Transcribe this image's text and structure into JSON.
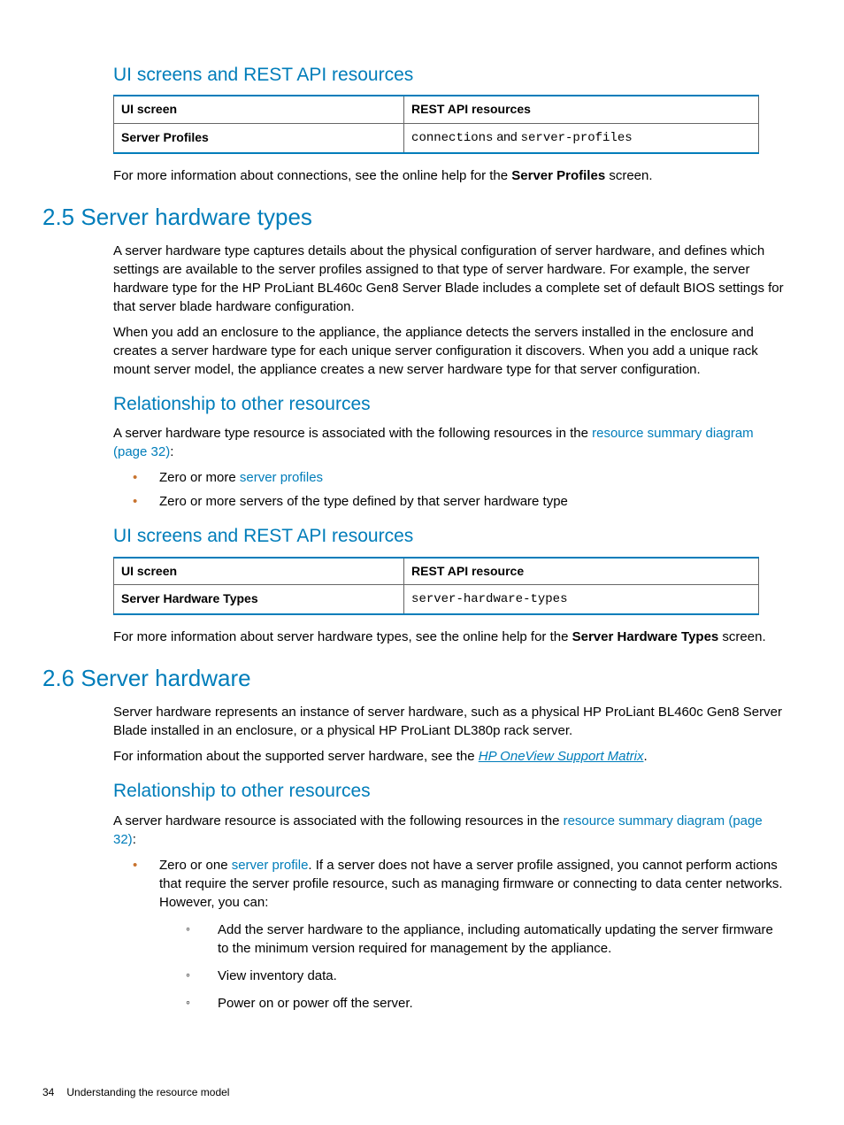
{
  "heading_ui_rest_1": "UI screens and REST API resources",
  "table1": {
    "h1": "UI screen",
    "h2": "REST API resources",
    "c1": "Server Profiles",
    "c2a": "connections",
    "c2_and": " and ",
    "c2b": "server-profiles"
  },
  "para_more_conn_a": "For more information about connections, see the online help for the ",
  "para_more_conn_b": "Server Profiles",
  "para_more_conn_c": " screen.",
  "sec25": "2.5 Server hardware types",
  "p25a": "A server hardware type captures details about the physical configuration of server hardware, and defines which settings are available to the server profiles assigned to that type of server hardware. For example, the server hardware type for the HP ProLiant BL460c Gen8 Server Blade includes a complete set of default BIOS settings for that server blade hardware configuration.",
  "p25b": "When you add an enclosure to the appliance, the appliance detects the servers installed in the enclosure and creates a server hardware type for each unique server configuration it discovers. When you add a unique rack mount server model, the appliance creates a new server hardware type for that server configuration.",
  "rel_heading": "Relationship to other resources",
  "rel25_a": "A server hardware type resource is associated with the following resources in the ",
  "rel25_link": "resource summary diagram (page 32)",
  "rel25_colon": ":",
  "li25_1a": "Zero or more ",
  "li25_1b": "server profiles",
  "li25_2": "Zero or more servers of the type defined by that server hardware type",
  "heading_ui_rest_2": "UI screens and REST API resources",
  "table2": {
    "h1": "UI screen",
    "h2": "REST API resource",
    "c1": "Server Hardware Types",
    "c2": "server-hardware-types"
  },
  "para_more_sht_a": "For more information about server hardware types, see the online help for the ",
  "para_more_sht_b": "Server Hardware Types",
  "para_more_sht_c": " screen.",
  "sec26": "2.6 Server hardware",
  "p26a": "Server hardware represents an instance of server hardware, such as a physical HP ProLiant BL460c Gen8 Server Blade installed in an enclosure, or a physical HP ProLiant DL380p rack server.",
  "p26b_a": "For information about the supported server hardware, see the ",
  "p26b_link": "HP OneView Support Matrix",
  "p26b_c": ".",
  "rel26_a": "A server hardware resource is associated with the following resources in the ",
  "rel26_link": "resource summary diagram (page 32)",
  "rel26_colon": ":",
  "li26_1a": "Zero or one ",
  "li26_1b": "server profile",
  "li26_1c": ". If a server does not have a server profile assigned, you cannot perform actions that require the server profile resource, such as managing firmware or connecting to data center networks. However, you can:",
  "li26_1_s1": "Add the server hardware to the appliance, including automatically updating the server firmware to the minimum version required for management by the appliance.",
  "li26_1_s2": "View inventory data.",
  "li26_1_s3": "Power on or power off the server.",
  "footer_page": "34",
  "footer_title": "Understanding the resource model"
}
